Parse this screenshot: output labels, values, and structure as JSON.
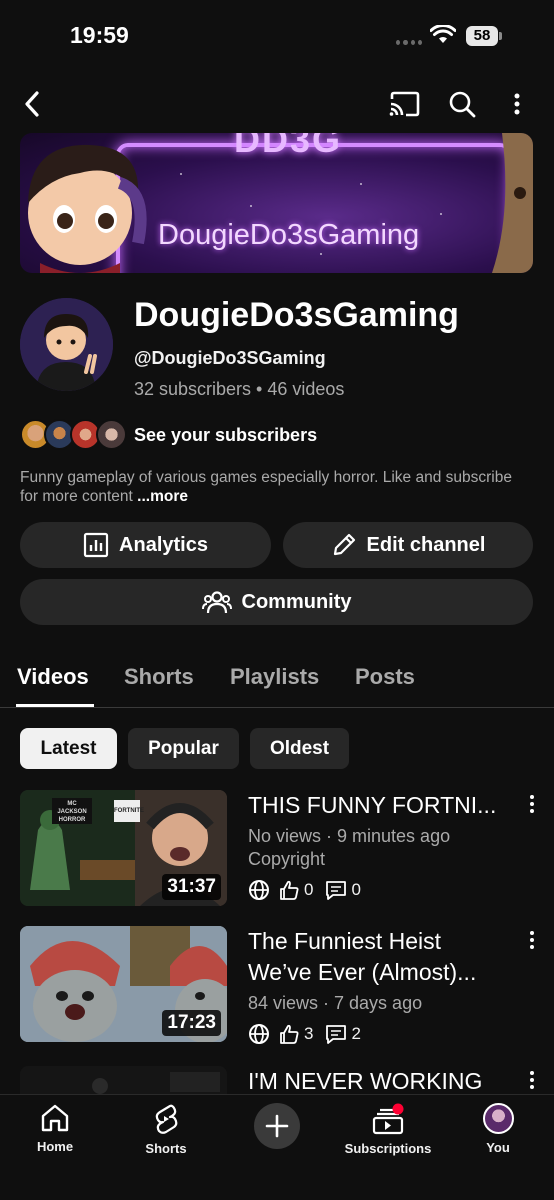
{
  "status": {
    "time": "19:59",
    "battery": "58"
  },
  "banner": {
    "logo_text": "DD3G",
    "name_text": "DougieDo3sGaming"
  },
  "channel": {
    "title": "DougieDo3sGaming",
    "handle": "@DougieDo3SGaming",
    "stats": "32 subscribers • 46 videos",
    "see_subscribers": "See your subscribers",
    "description": "Funny gameplay of various games especially horror. Like and subscribe for more content",
    "more_label": "...more"
  },
  "actions": {
    "analytics": "Analytics",
    "edit_channel": "Edit channel",
    "community": "Community"
  },
  "tabs": [
    {
      "label": "Videos",
      "active": true
    },
    {
      "label": "Shorts"
    },
    {
      "label": "Playlists"
    },
    {
      "label": "Posts"
    }
  ],
  "filters": [
    {
      "label": "Latest",
      "active": true
    },
    {
      "label": "Popular"
    },
    {
      "label": "Oldest"
    }
  ],
  "videos": [
    {
      "title": "THIS FUNNY FORTNI...",
      "meta_line1": "No views · 9 minutes ago",
      "meta_line2": "Copyright",
      "duration": "31:37",
      "thumb_badge_1": "MC JACKSON",
      "thumb_badge_2": "HORROR",
      "thumb_badge_3": "FORTNITE",
      "likes": "0",
      "comments": "0"
    },
    {
      "title_line1": "The Funniest Heist",
      "title_line2": "We’ve Ever (Almost)...",
      "meta_line1": "84 views · 7 days ago",
      "duration": "17:23",
      "likes": "3",
      "comments": "2"
    },
    {
      "title": "I'M NEVER WORKING"
    }
  ],
  "bottom_nav": {
    "home": "Home",
    "shorts": "Shorts",
    "subscriptions": "Subscriptions",
    "you": "You"
  },
  "colors": {
    "background": "#0f0f0f",
    "surface": "#272727",
    "text_primary": "#f1f1f1",
    "text_secondary": "#aaaaaa",
    "notification_dot": "#ff0033",
    "banner_neon": "#d48cff"
  }
}
